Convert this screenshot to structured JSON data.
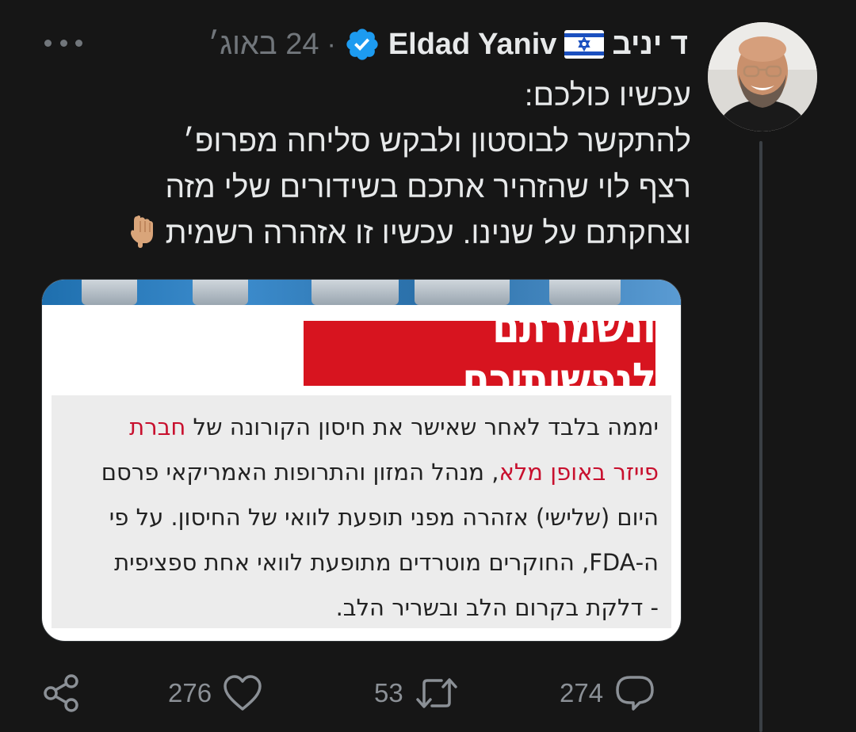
{
  "author": {
    "name_hebrew": "ד יניב",
    "name_english": "Eldad Yaniv",
    "flag_icon": "israel-flag-icon",
    "verified_icon": "verified-badge-icon",
    "separator": "·",
    "date": "24 באוג׳"
  },
  "tweet": {
    "lines": [
      "עכשיו כולכם:",
      "להתקשר לבוסטון ולבקש סליחה מפרופ׳",
      "רצף לוי שהזהיר אתכם בשידורים שלי מזה",
      "וצחקתם על שנינו. עכשיו זו אזהרה רשמית"
    ],
    "emoji_icon": "pointing-down-icon"
  },
  "embedded_image": {
    "headline": "ונשמרתם לנפשותיכם",
    "article": {
      "line1_prefix": "יממה בלבד לאחר שאישר את חיסון הקורונה של",
      "line1_red": "חברת",
      "line2_red": "פייזר באופן מלא",
      "line2_rest": ", מנהל המזון והתרופות האמריקאי פרסם",
      "line3": "היום (שלישי) אזהרה מפני תופעת לוואי של החיסון. על פי",
      "line4": "ה-FDA, החוקרים מוטרדים מתופעת לוואי אחת ספציפית",
      "line5": "- דלקת בקרום הלב ובשריר הלב."
    }
  },
  "actions": {
    "replies": "274",
    "retweets": "53",
    "likes": "276"
  },
  "colors": {
    "background": "#161616",
    "text": "#e7e9ea",
    "muted": "#71767b",
    "verified": "#1d9bf0",
    "headline_red": "#d7141f",
    "article_red": "#c8102e"
  }
}
